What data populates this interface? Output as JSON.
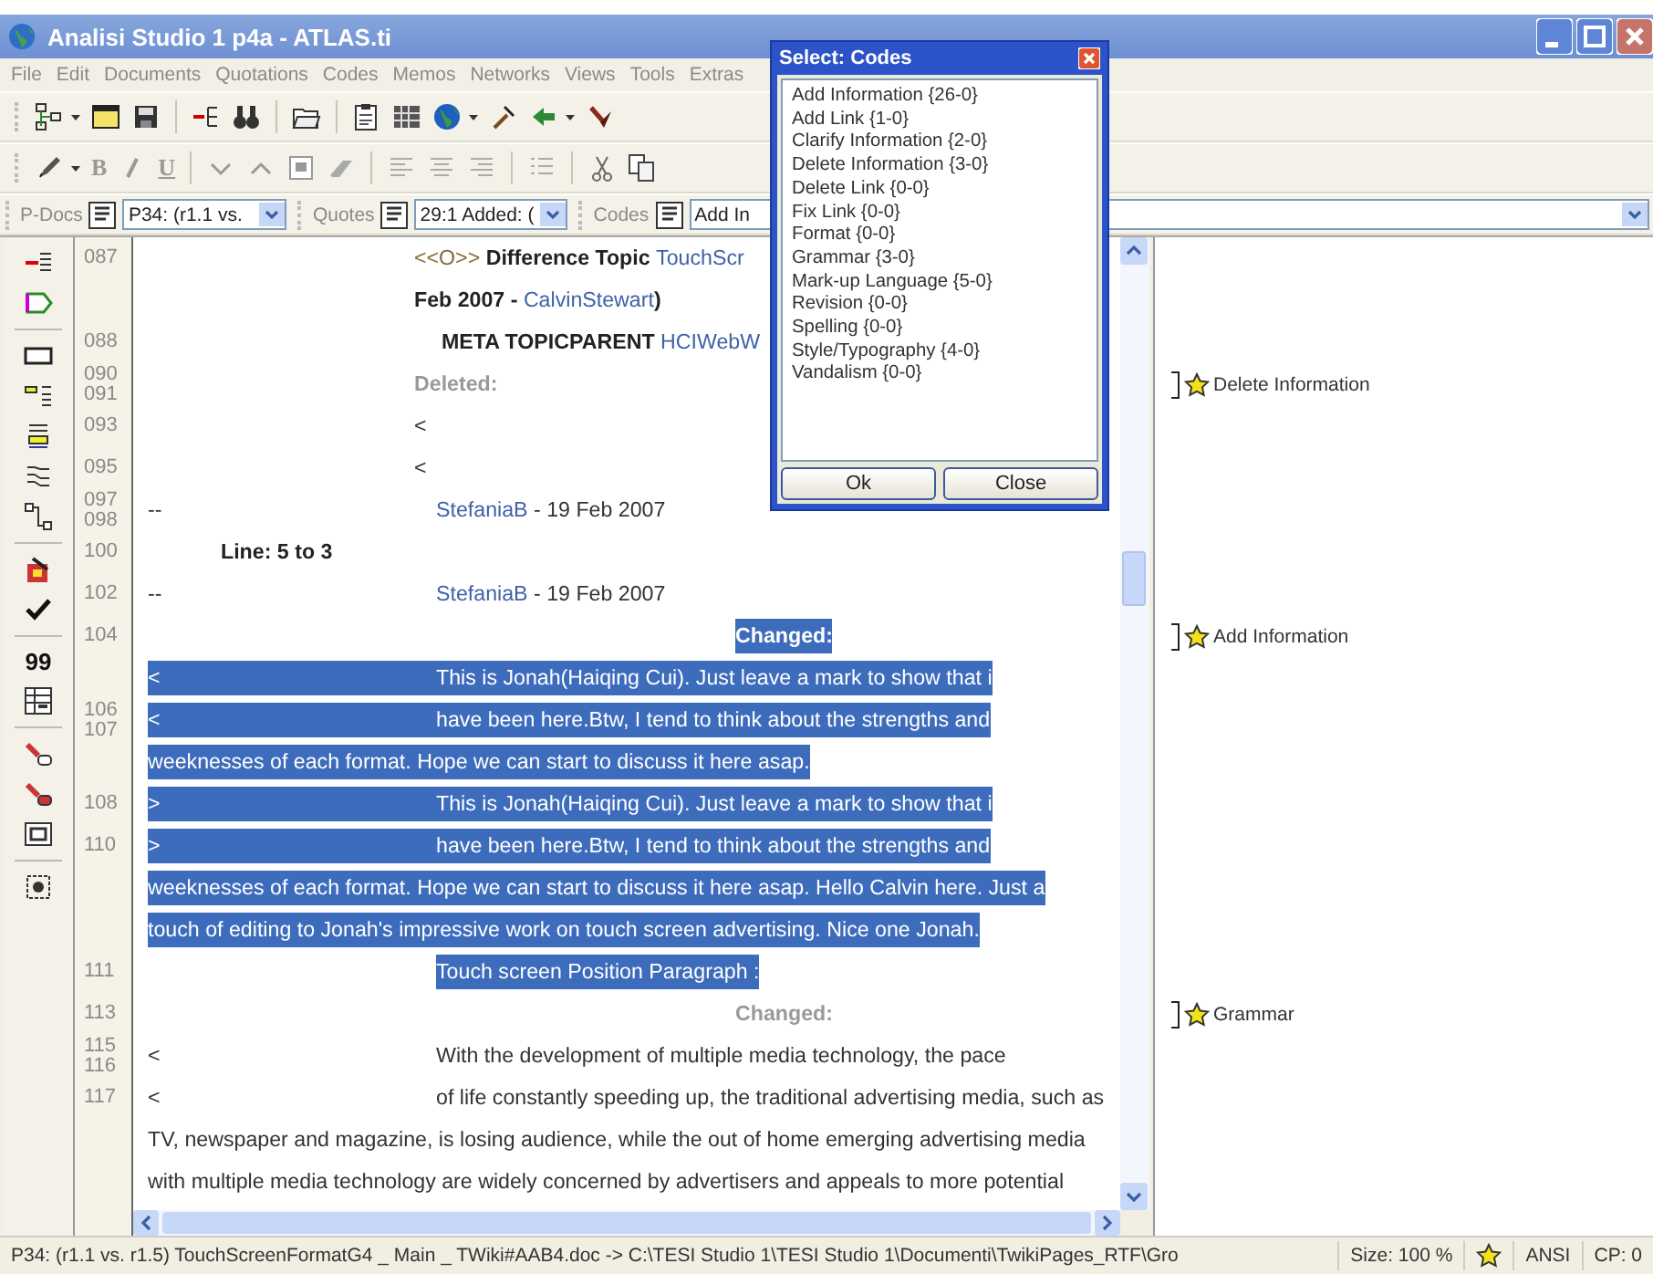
{
  "window": {
    "title": "Analisi Studio 1 p4a - ATLAS.ti"
  },
  "menu": [
    "File",
    "Edit",
    "Documents",
    "Quotations",
    "Codes",
    "Memos",
    "Networks",
    "Views",
    "Tools",
    "Extras"
  ],
  "format_toolbar": {
    "bold": "B",
    "underline": "U"
  },
  "selector_bar": [
    {
      "label": "P-Docs",
      "value": "P34: (r1.1 vs."
    },
    {
      "label": "Quotes",
      "value": "29:1 Added: ("
    },
    {
      "label": "Codes",
      "value": "Add In"
    }
  ],
  "left_toolbar": {
    "quote_button": "99"
  },
  "document": {
    "rows": [
      {
        "numbers": [
          "087"
        ],
        "kind": "tab",
        "selected": false,
        "parts": [
          {
            "kind": "tag",
            "text": "<<O>> "
          },
          {
            "kind": "strong",
            "text": "Difference Topic "
          },
          {
            "kind": "link",
            "text": "TouchScr"
          }
        ]
      },
      {
        "kind": "tab",
        "selected": false,
        "parts": [
          {
            "kind": "strong",
            "text": "Feb 2007 - "
          },
          {
            "kind": "link",
            "text": "CalvinStewart"
          },
          {
            "kind": "strong",
            "text": ")"
          }
        ]
      },
      {
        "numbers": [
          "088"
        ],
        "kind": "subtab",
        "selected": false,
        "parts": [
          {
            "kind": "strong",
            "text": "META TOPICPARENT "
          },
          {
            "kind": "link",
            "text": "HCIWebW"
          }
        ]
      },
      {
        "numbers": [
          "090",
          "091"
        ],
        "kind": "tab",
        "selected": false,
        "parts": [
          {
            "kind": "muted",
            "text": "Deleted:"
          }
        ],
        "code": "Delete Information"
      },
      {
        "numbers": [
          "093"
        ],
        "kind": "tab",
        "selected": false,
        "parts": [
          {
            "kind": "plain",
            "text": "<"
          }
        ]
      },
      {
        "numbers": [
          "095"
        ],
        "kind": "tab",
        "selected": false,
        "parts": [
          {
            "kind": "plain",
            "text": "<"
          }
        ]
      },
      {
        "numbers": [
          "097",
          "098"
        ],
        "kind": "indent",
        "prefix": "--",
        "selected": false,
        "parts": [
          {
            "kind": "link",
            "text": "StefaniaB"
          },
          {
            "kind": "plain",
            "text": " - 19 Feb 2007"
          }
        ]
      },
      {
        "numbers": [
          "100"
        ],
        "kind": "label",
        "selected": false,
        "parts": [
          {
            "kind": "strong",
            "text": "Line: 5 to 3"
          }
        ]
      },
      {
        "numbers": [
          "102"
        ],
        "kind": "indent",
        "prefix": "--",
        "selected": false,
        "parts": [
          {
            "kind": "link",
            "text": "StefaniaB"
          },
          {
            "kind": "plain",
            "text": " - 19 Feb 2007"
          }
        ]
      },
      {
        "numbers": [
          "104"
        ],
        "kind": "heading",
        "selected": true,
        "parts": [
          {
            "kind": "strong",
            "text": "Changed:"
          }
        ],
        "code": "Add Information"
      },
      {
        "kind": "indent",
        "prefix": "<",
        "selected": true,
        "parts": [
          {
            "kind": "plain",
            "text": "This is Jonah(Haiqing Cui). Just leave a mark to show that i"
          }
        ]
      },
      {
        "numbers": [
          "106",
          "107"
        ],
        "kind": "indent",
        "prefix": "<",
        "selected": true,
        "parts": [
          {
            "kind": "plain",
            "text": "have been here.Btw, I tend to think about the strengths and"
          }
        ]
      },
      {
        "kind": "wrap",
        "selected": true,
        "parts": [
          {
            "kind": "plain",
            "text": "weeknesses of each format. Hope we can start to discuss it here asap."
          }
        ]
      },
      {
        "numbers": [
          "108"
        ],
        "kind": "indent",
        "prefix": ">",
        "selected": true,
        "parts": [
          {
            "kind": "plain",
            "text": "This is Jonah(Haiqing Cui). Just leave a mark to show that i"
          }
        ]
      },
      {
        "numbers": [
          "110"
        ],
        "kind": "indent",
        "prefix": ">",
        "selected": true,
        "parts": [
          {
            "kind": "plain",
            "text": "have been here.Btw, I tend to think about the strengths and"
          }
        ]
      },
      {
        "kind": "wrap",
        "selected": true,
        "parts": [
          {
            "kind": "plain",
            "text": "weeknesses of each format. Hope we can start to discuss it here asap. Hello Calvin here. Just a"
          }
        ]
      },
      {
        "kind": "wrap",
        "selected": true,
        "parts": [
          {
            "kind": "plain",
            "text": "touch of editing to Jonah's impressive work on touch screen advertising. Nice one Jonah."
          }
        ]
      },
      {
        "numbers": [
          "111"
        ],
        "kind": "indent",
        "selected": true,
        "parts": [
          {
            "kind": "plain",
            "text": "Touch screen Position Paragraph :"
          }
        ]
      },
      {
        "numbers": [
          "113"
        ],
        "kind": "heading",
        "selected": false,
        "parts": [
          {
            "kind": "muted",
            "text": "Changed:"
          }
        ],
        "code": "Grammar"
      },
      {
        "numbers": [
          "115",
          "116"
        ],
        "kind": "indent",
        "prefix": "<",
        "selected": false,
        "parts": [
          {
            "kind": "plain",
            "text": "With the development of multiple media technology, the pace"
          }
        ]
      },
      {
        "numbers": [
          "117"
        ],
        "kind": "indent",
        "prefix": "<",
        "selected": false,
        "parts": [
          {
            "kind": "plain",
            "text": "of life constantly speeding up, the traditional advertising media, such as"
          }
        ]
      },
      {
        "kind": "wrap",
        "selected": false,
        "parts": [
          {
            "kind": "plain",
            "text": "TV, newspaper and magazine, is losing audience, while the out of home emerging advertising media"
          }
        ]
      },
      {
        "kind": "wrap",
        "selected": false,
        "parts": [
          {
            "kind": "plain",
            "text": "with multiple media technology are widely concerned by advertisers and appeals to more potential"
          }
        ]
      }
    ]
  },
  "dialog": {
    "title": "Select: Codes",
    "items": [
      {
        "label": "Add Information {26-0}",
        "selected": false
      },
      {
        "label": "Add Link {1-0}",
        "selected": false
      },
      {
        "label": "Clarify Information {2-0}",
        "selected": false
      },
      {
        "label": "Delete Information {3-0}",
        "selected": false
      },
      {
        "label": "Delete Link {0-0}",
        "selected": false
      },
      {
        "label": "Fix Link {0-0}",
        "selected": false
      },
      {
        "label": "Format {0-0}",
        "selected": false
      },
      {
        "label": "Grammar {3-0}",
        "selected": false
      },
      {
        "label": "Mark-up Language {5-0}",
        "selected": false
      },
      {
        "label": "Revision {0-0}",
        "selected": false
      },
      {
        "label": "Spelling {0-0}",
        "selected": false
      },
      {
        "label": "Style/Typography {4-0}",
        "selected": false
      },
      {
        "label": "Vandalism {0-0}",
        "selected": false
      }
    ],
    "buttons": [
      "Ok",
      "Close"
    ]
  },
  "status_bar": {
    "path": "P34: (r1.1 vs. r1.5) TouchScreenFormatG4 _ Main _ TWiki#AAB4.doc -> C:\\TESI Studio 1\\TESI Studio 1\\Documenti\\TwikiPages_RTF\\Gro",
    "size": "Size: 100 %",
    "encoding": "ANSI",
    "cp": "CP: 0"
  }
}
